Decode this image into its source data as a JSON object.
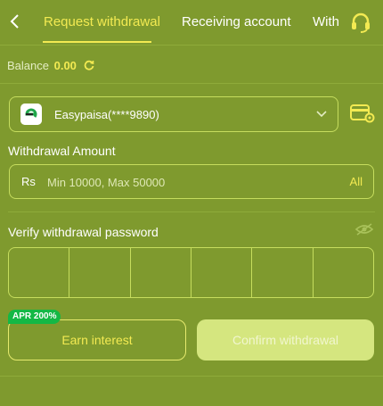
{
  "header": {
    "tabs": [
      {
        "label": "Request withdrawal",
        "active": true
      },
      {
        "label": "Receiving account",
        "active": false
      },
      {
        "label": "With",
        "active": false
      }
    ]
  },
  "balance": {
    "label": "Balance",
    "amount": "0.00"
  },
  "channel": {
    "selected": "Easypaisa(****9890)"
  },
  "withdrawal_amount": {
    "label": "Withdrawal Amount",
    "currency": "Rs",
    "placeholder": "Min 10000, Max 50000",
    "all_label": "All"
  },
  "password": {
    "label": "Verify withdrawal password",
    "digits": 6
  },
  "actions": {
    "earn_label": "Earn interest",
    "apr_badge": "APR 200%",
    "confirm_label": "Confirm withdrawal"
  },
  "colors": {
    "accent": "#f3ea52",
    "background": "#7f9a2e",
    "badge": "#14b845"
  }
}
